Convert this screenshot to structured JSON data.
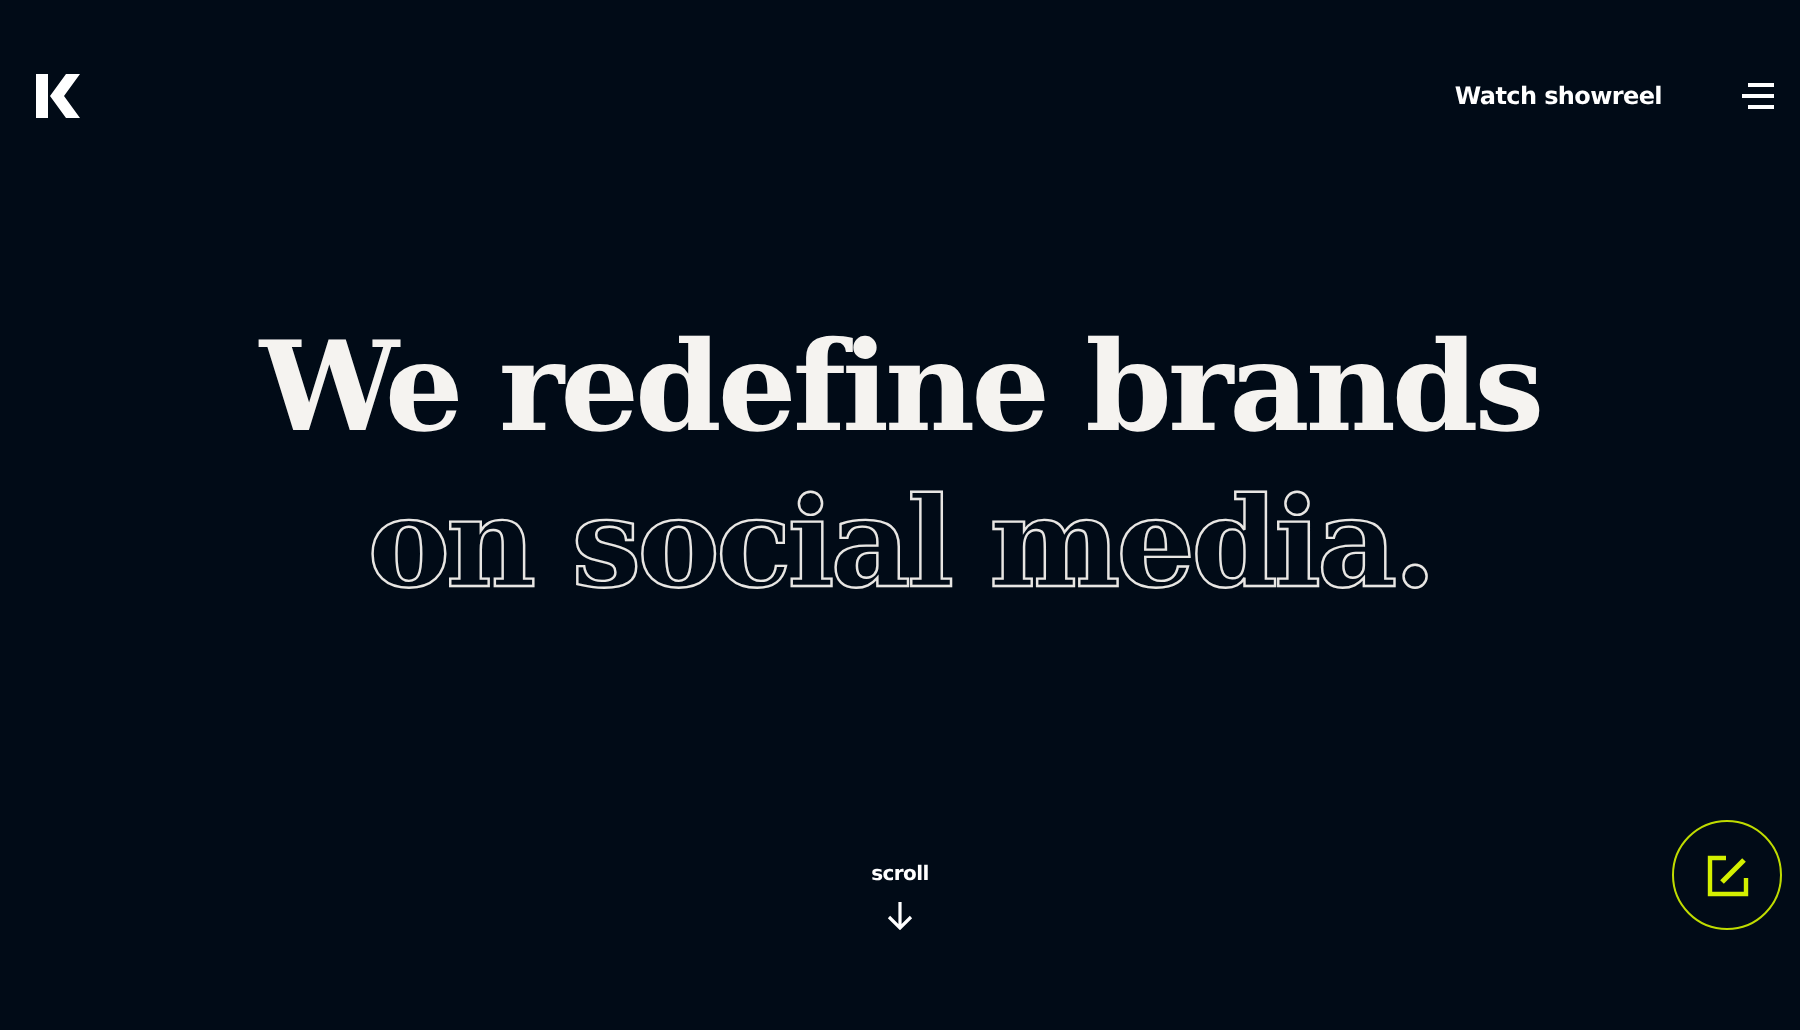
{
  "header": {
    "link": "Watch showreel"
  },
  "hero": {
    "line_1": "We redefine brands",
    "line_2": "on social media."
  },
  "scroll": {
    "label": "scroll"
  }
}
